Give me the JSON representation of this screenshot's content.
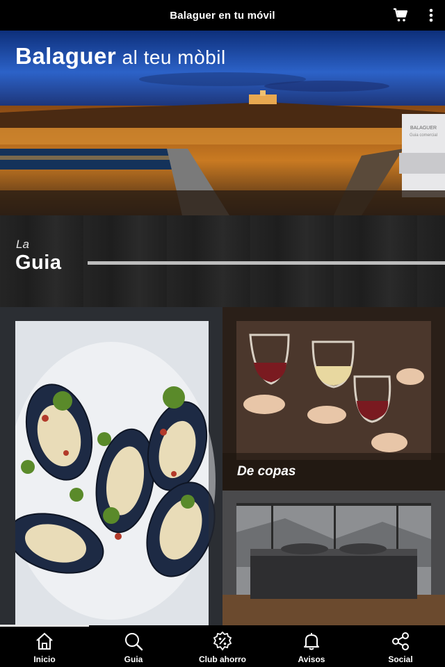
{
  "topbar": {
    "title": "Balaguer en tu móvil",
    "cart_icon": "shopping-cart-icon",
    "menu_icon": "more-vertical-icon"
  },
  "hero": {
    "tagline_bold": "Balaguer",
    "tagline_light": " al teu mòbil",
    "sign_text_1": "BALAGUER",
    "sign_text_2": "Guia comercial"
  },
  "section": {
    "prefix": "La",
    "title": "Guia"
  },
  "tiles": [
    {
      "id": "food",
      "label": ""
    },
    {
      "id": "drinks",
      "label": "De copas"
    },
    {
      "id": "rooms",
      "label": ""
    }
  ],
  "bottom_nav": [
    {
      "label": "Inicio",
      "icon": "home-icon"
    },
    {
      "label": "Guia",
      "icon": "search-icon"
    },
    {
      "label": "Club ahorro",
      "icon": "percent-badge-icon"
    },
    {
      "label": "Avisos",
      "icon": "bell-icon"
    },
    {
      "label": "Social",
      "icon": "share-icon"
    }
  ],
  "colors": {
    "bar_bg": "#000000",
    "accent_line": "#bdbdbd",
    "text": "#ffffff"
  }
}
